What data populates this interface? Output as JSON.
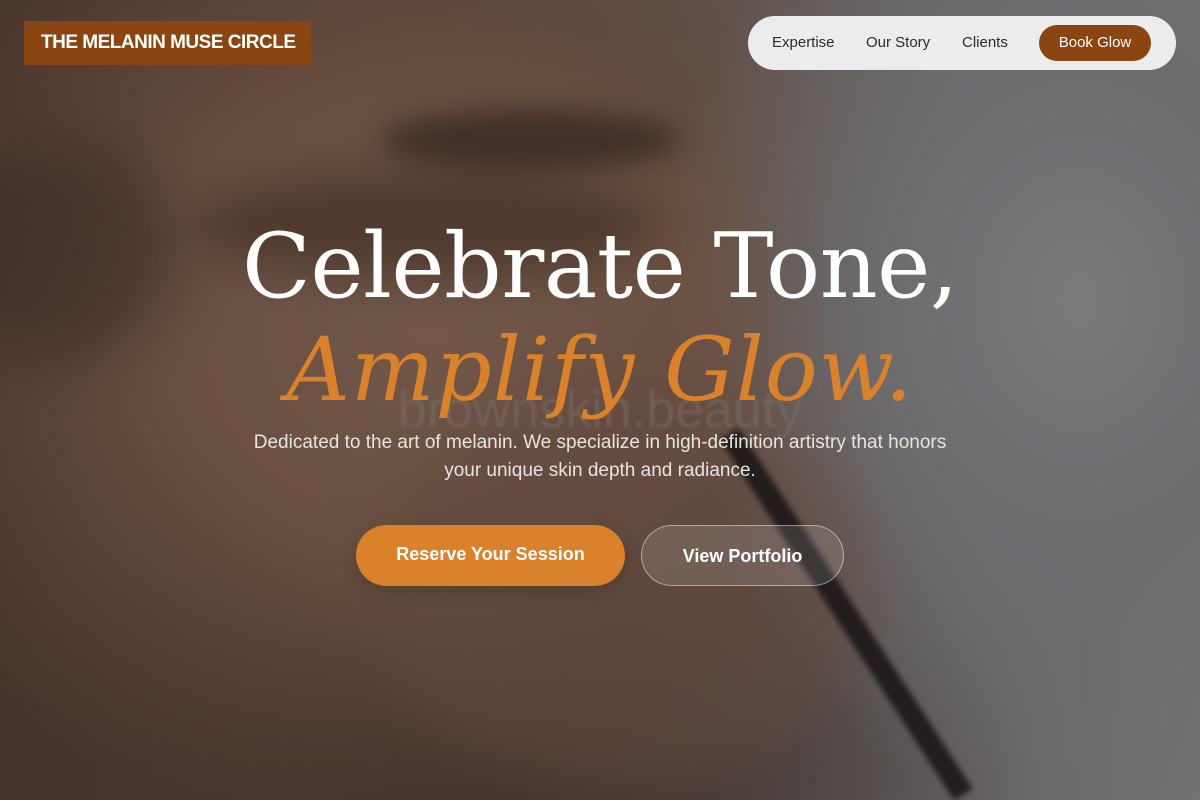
{
  "brand": {
    "name": "THE MELANIN MUSE CIRCLE"
  },
  "nav": {
    "links": [
      "Expertise",
      "Our Story",
      "Clients"
    ],
    "cta_label": "Book Glow"
  },
  "hero": {
    "headline_line1": "Celebrate Tone,",
    "headline_line2": "Amplify Glow.",
    "watermark": "brownskin.beauty",
    "subtext": "Dedicated to the art of melanin. We specialize in high-definition artistry that honors your unique skin depth and radiance.",
    "primary_button_label": "Reserve Your Session",
    "secondary_button_label": "View Portfolio"
  },
  "colors": {
    "brand_brown": "#8b4513",
    "accent_orange": "#d9822b",
    "nav_background": "#ececee"
  }
}
